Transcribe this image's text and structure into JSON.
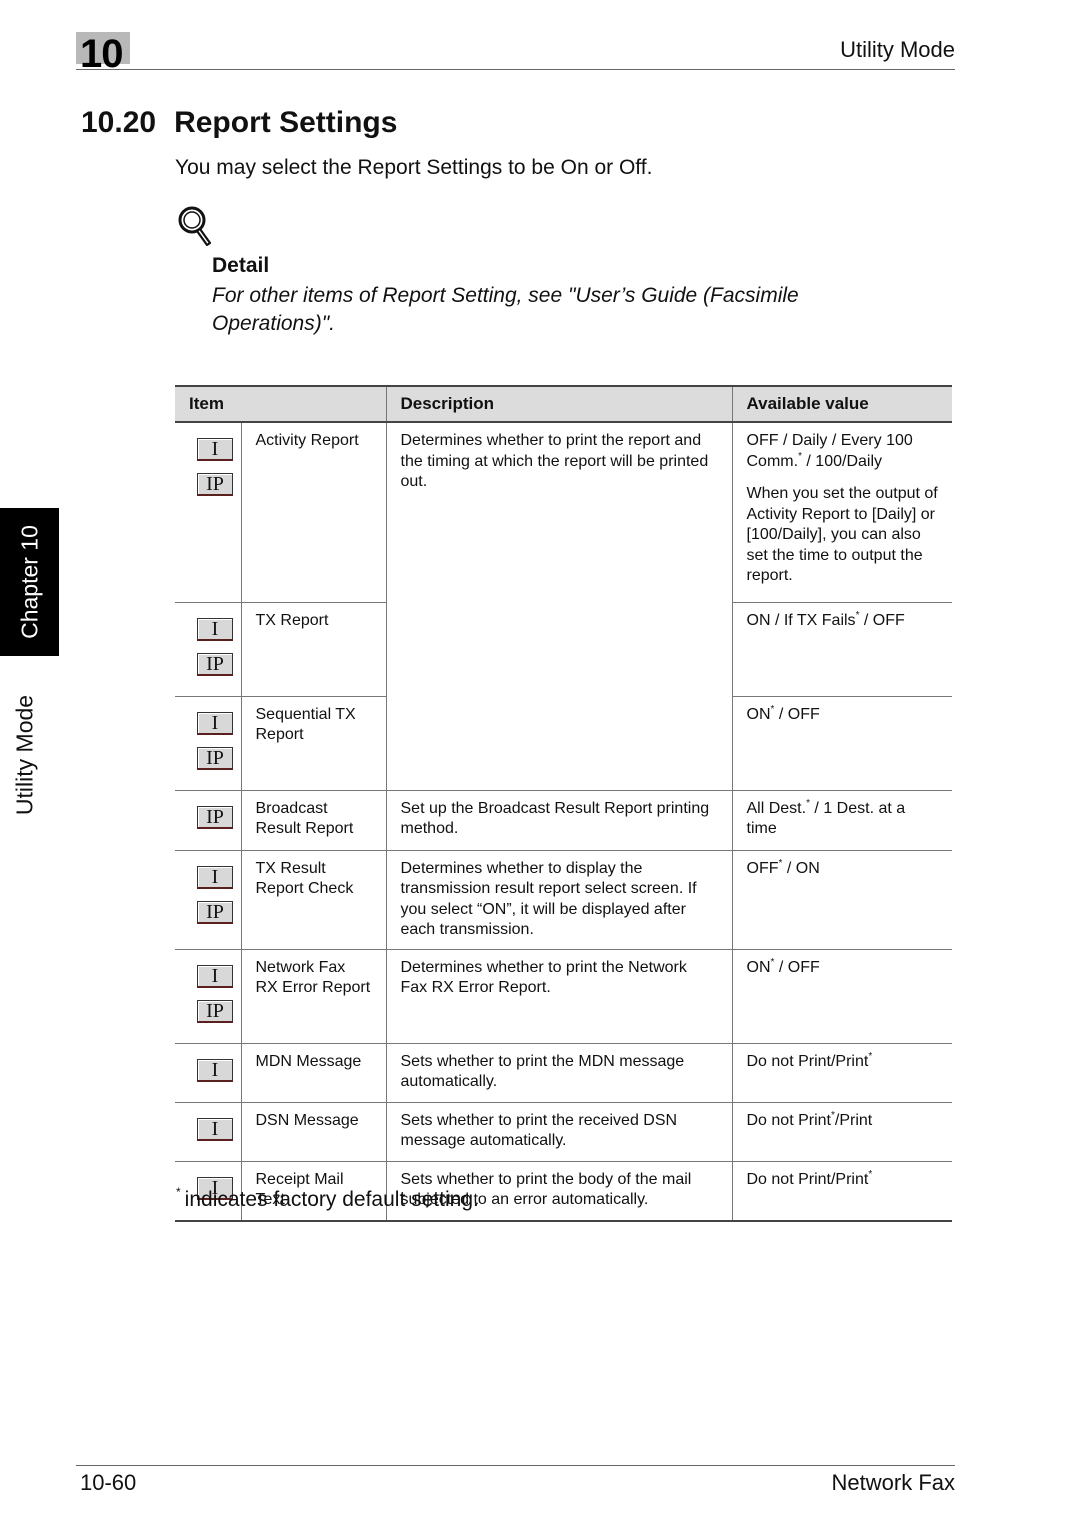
{
  "header": {
    "chapter_number": "10",
    "title": "Utility Mode"
  },
  "section": {
    "number": "10.20",
    "title": "Report Settings",
    "intro": "You may select the Report Settings to be On or Off."
  },
  "detail": {
    "icon": "magnifier-icon",
    "label": "Detail",
    "text": "For other items of Report Setting, see \"User’s Guide (Facsimile Operations)\"."
  },
  "side_tab": {
    "chapter": "Chapter 10",
    "mode": "Utility Mode"
  },
  "table": {
    "headers": {
      "item": "Item",
      "description": "Description",
      "value": "Available value"
    },
    "rows": [
      {
        "icons": [
          "I",
          "IP"
        ],
        "item": "Activity Report",
        "description": "Determines whether to print the report and the timing at which the report will be printed out.",
        "value_parts": [
          "OFF / Daily / Every 100 Comm.",
          "*",
          " / 100/Daily"
        ],
        "value_note": "When you set the output of Activity Report to [Daily] or [100/Daily], you can also set the time to output the report."
      },
      {
        "icons": [
          "I",
          "IP"
        ],
        "item": "TX Report",
        "description": "",
        "value_parts": [
          "ON / If TX Fails",
          "*",
          " / OFF"
        ]
      },
      {
        "icons": [
          "I",
          "IP"
        ],
        "item": "Sequential TX Report",
        "description": "",
        "value_parts": [
          "ON",
          "*",
          " / OFF"
        ]
      },
      {
        "icons": [
          "IP"
        ],
        "item": "Broadcast Result Report",
        "description": "Set up the Broadcast Result Report printing method.",
        "value_parts": [
          "All Dest.",
          "*",
          " / 1 Dest. at a time"
        ]
      },
      {
        "icons": [
          "I",
          "IP"
        ],
        "item": "TX Result Report Check",
        "description": "Determines whether to display the transmission result report select screen. If you select “ON”, it will be displayed after each transmission.",
        "value_parts": [
          "OFF",
          "*",
          " / ON"
        ]
      },
      {
        "icons": [
          "I",
          "IP"
        ],
        "item": "Network Fax RX Error Report",
        "description": "Determines whether to print the Network Fax RX Error Report.",
        "value_parts": [
          "ON",
          "*",
          " / OFF"
        ]
      },
      {
        "icons": [
          "I"
        ],
        "item": "MDN Message",
        "description": "Sets whether to print the MDN message automatically.",
        "value_parts": [
          "Do not Print/Print",
          "*",
          ""
        ]
      },
      {
        "icons": [
          "I"
        ],
        "item": "DSN Message",
        "description": "Sets whether to print the received DSN message automatically.",
        "value_parts": [
          "Do not Print",
          "*",
          "/Print"
        ]
      },
      {
        "icons": [
          "I"
        ],
        "item": "Receipt Mail Text",
        "description": "Sets whether to print the body of the mail subjected to an error automatically.",
        "value_parts": [
          "Do not Print/Print",
          "*",
          ""
        ]
      }
    ]
  },
  "footnote": {
    "mark": "*",
    "text": "indicates factory default setting."
  },
  "footer": {
    "page": "10-60",
    "title": "Network Fax"
  }
}
